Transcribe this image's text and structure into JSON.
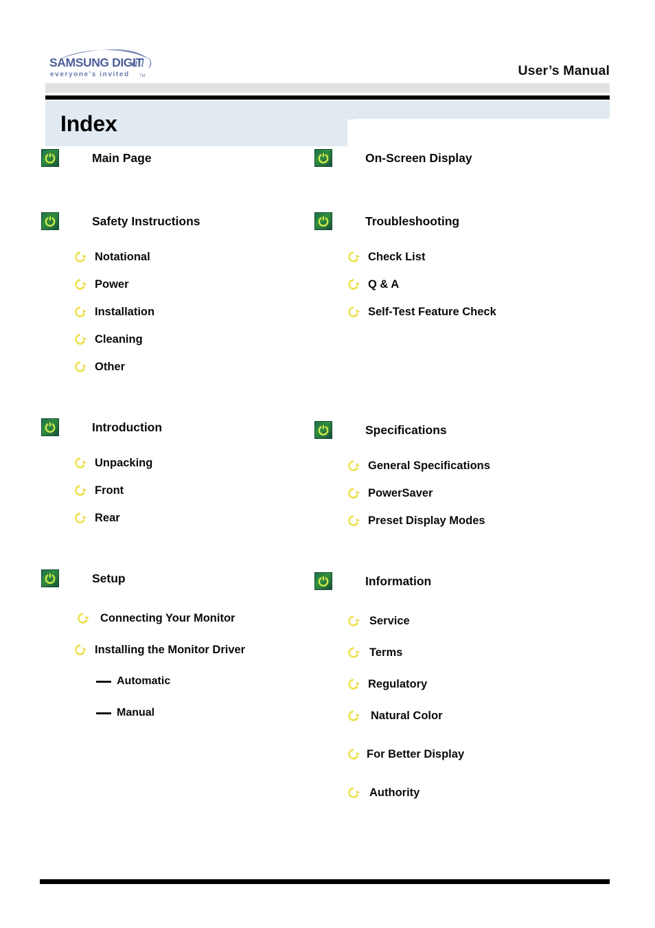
{
  "header": {
    "logo_main": "SAMSUNG DIGIT",
    "logo_main_italic": "all",
    "logo_tagline": "everyone's invited",
    "logo_tm": "TM",
    "manual_title": "User’s Manual"
  },
  "page": {
    "title": "Index"
  },
  "colors": {
    "tab_band": "#e0eaf0",
    "header_grey": "#e2e2e3",
    "rule_black": "#000000",
    "icon_green_dark": "#14513a",
    "icon_green_light": "#2f8f3f",
    "icon_green_glyph": "#c9e84a",
    "icon_yellow": "#e8dc4a",
    "logo_blue": "#5b6fa8",
    "text": "#0a0a0a"
  },
  "icons": {
    "top": "power-button-green-icon",
    "sub": "circular-arrow-yellow-icon",
    "leaf": "em-dash-icon"
  },
  "columns": {
    "left": [
      {
        "id": "main-page",
        "heading": "Main Page",
        "children": []
      },
      {
        "id": "safety-instructions",
        "heading": "Safety Instructions",
        "children": [
          {
            "id": "notational",
            "label": "Notational"
          },
          {
            "id": "power",
            "label": "Power"
          },
          {
            "id": "installation",
            "label": "Installation"
          },
          {
            "id": "cleaning",
            "label": "Cleaning"
          },
          {
            "id": "other",
            "label": "Other"
          }
        ]
      },
      {
        "id": "introduction",
        "heading": "Introduction",
        "children": [
          {
            "id": "unpacking",
            "label": "Unpacking"
          },
          {
            "id": "front",
            "label": "Front"
          },
          {
            "id": "rear",
            "label": "Rear"
          }
        ]
      },
      {
        "id": "setup",
        "heading": "Setup",
        "children": [
          {
            "id": "connecting-your-monitor",
            "label": "Connecting Your Monitor"
          },
          {
            "id": "installing-the-monitor-driver",
            "label": "Installing the Monitor Driver",
            "children": [
              {
                "id": "automatic",
                "label": "Automatic"
              },
              {
                "id": "manual",
                "label": "Manual"
              }
            ]
          }
        ]
      }
    ],
    "right": [
      {
        "id": "on-screen-display",
        "heading": "On-Screen Display",
        "children": []
      },
      {
        "id": "troubleshooting",
        "heading": "Troubleshooting",
        "children": [
          {
            "id": "check-list",
            "label": "Check List"
          },
          {
            "id": "q-and-a",
            "label": "Q & A"
          },
          {
            "id": "self-test-feature-check",
            "label": "Self-Test Feature Check"
          }
        ]
      },
      {
        "id": "specifications",
        "heading": "Specifications",
        "children": [
          {
            "id": "general-specifications",
            "label": "General Specifications"
          },
          {
            "id": "powersaver",
            "label": "PowerSaver"
          },
          {
            "id": "preset-display-modes",
            "label": "Preset Display Modes"
          }
        ]
      },
      {
        "id": "information",
        "heading": "Information",
        "children": [
          {
            "id": "service",
            "label": "Service"
          },
          {
            "id": "terms",
            "label": "Terms"
          },
          {
            "id": "regulatory",
            "label": "Regulatory"
          },
          {
            "id": "natural-color",
            "label": "Natural Color"
          },
          {
            "id": "for-better-display",
            "label": "For Better Display"
          },
          {
            "id": "authority",
            "label": "Authority"
          }
        ]
      }
    ]
  }
}
